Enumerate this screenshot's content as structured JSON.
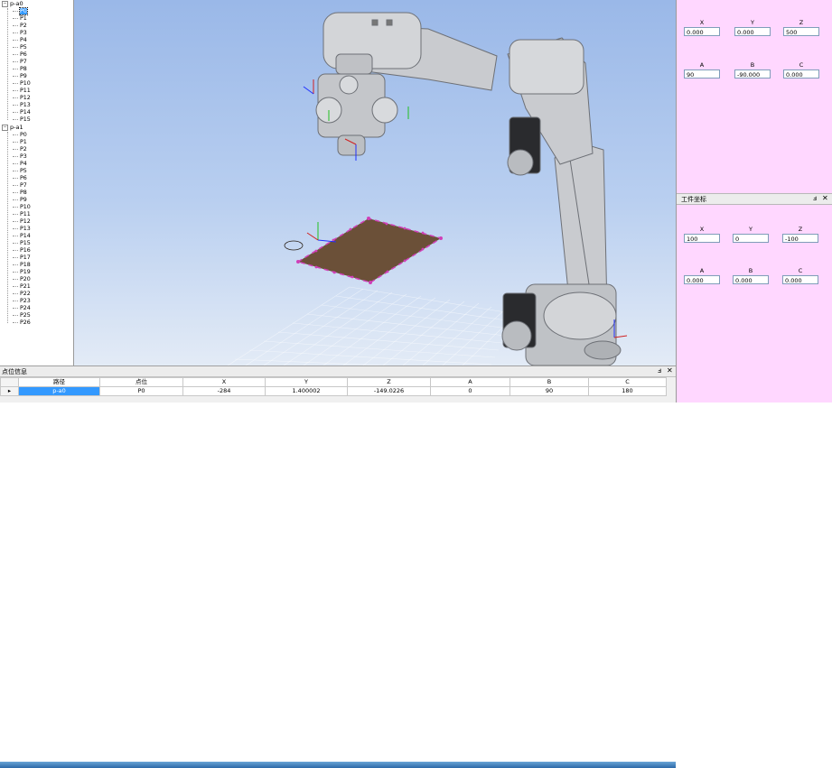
{
  "tree": {
    "groups": [
      {
        "label": "p-a0",
        "expander": "−",
        "items": [
          "P0",
          "P1",
          "P2",
          "P3",
          "P4",
          "P5",
          "P6",
          "P7",
          "P8",
          "P9",
          "P10",
          "P11",
          "P12",
          "P13",
          "P14",
          "P15"
        ],
        "selected": 0
      },
      {
        "label": "p-a1",
        "expander": "−",
        "items": [
          "P0",
          "P1",
          "P2",
          "P3",
          "P4",
          "P5",
          "P6",
          "P7",
          "P8",
          "P9",
          "P10",
          "P11",
          "P12",
          "P13",
          "P14",
          "P15",
          "P16",
          "P17",
          "P18",
          "P19",
          "P20",
          "P21",
          "P22",
          "P23",
          "P24",
          "P25",
          "P26"
        ],
        "selected": -1
      }
    ]
  },
  "tool_coords": {
    "labels": {
      "x": "X",
      "y": "Y",
      "z": "Z",
      "a": "A",
      "b": "B",
      "c": "C"
    },
    "values": {
      "x": "0.000",
      "y": "0.000",
      "z": "500",
      "a": "90",
      "b": "-90.000",
      "c": "0.000"
    }
  },
  "work_coords": {
    "title": "工件坐标",
    "pin": "ⅎ",
    "close": "✕",
    "labels": {
      "x": "X",
      "y": "Y",
      "z": "Z",
      "a": "A",
      "b": "B",
      "c": "C"
    },
    "values": {
      "x": "100",
      "y": "0",
      "z": "-100",
      "a": "0.000",
      "b": "0.000",
      "c": "0.000"
    }
  },
  "point_info": {
    "title": "点位信息",
    "pin": "ⅎ",
    "close": "✕",
    "columns": [
      "路径",
      "点位",
      "X",
      "Y",
      "Z",
      "A",
      "B",
      "C"
    ],
    "row": {
      "marker": "▸",
      "cells": [
        "p-a0",
        "P0",
        "-284",
        "1.400002",
        "-149.0226",
        "0",
        "90",
        "180"
      ]
    }
  },
  "colors": {
    "right_panel_bg": "#ffd7ff",
    "selection": "#3399ff",
    "viewport_top": "#9ab8e8",
    "plate": "#6b5038",
    "plate_edge": "#d03fb8"
  },
  "icons": {
    "expander": "tree-expander-icon",
    "pin": "pin-icon",
    "close": "close-icon",
    "row_marker": "row-pointer-icon"
  }
}
